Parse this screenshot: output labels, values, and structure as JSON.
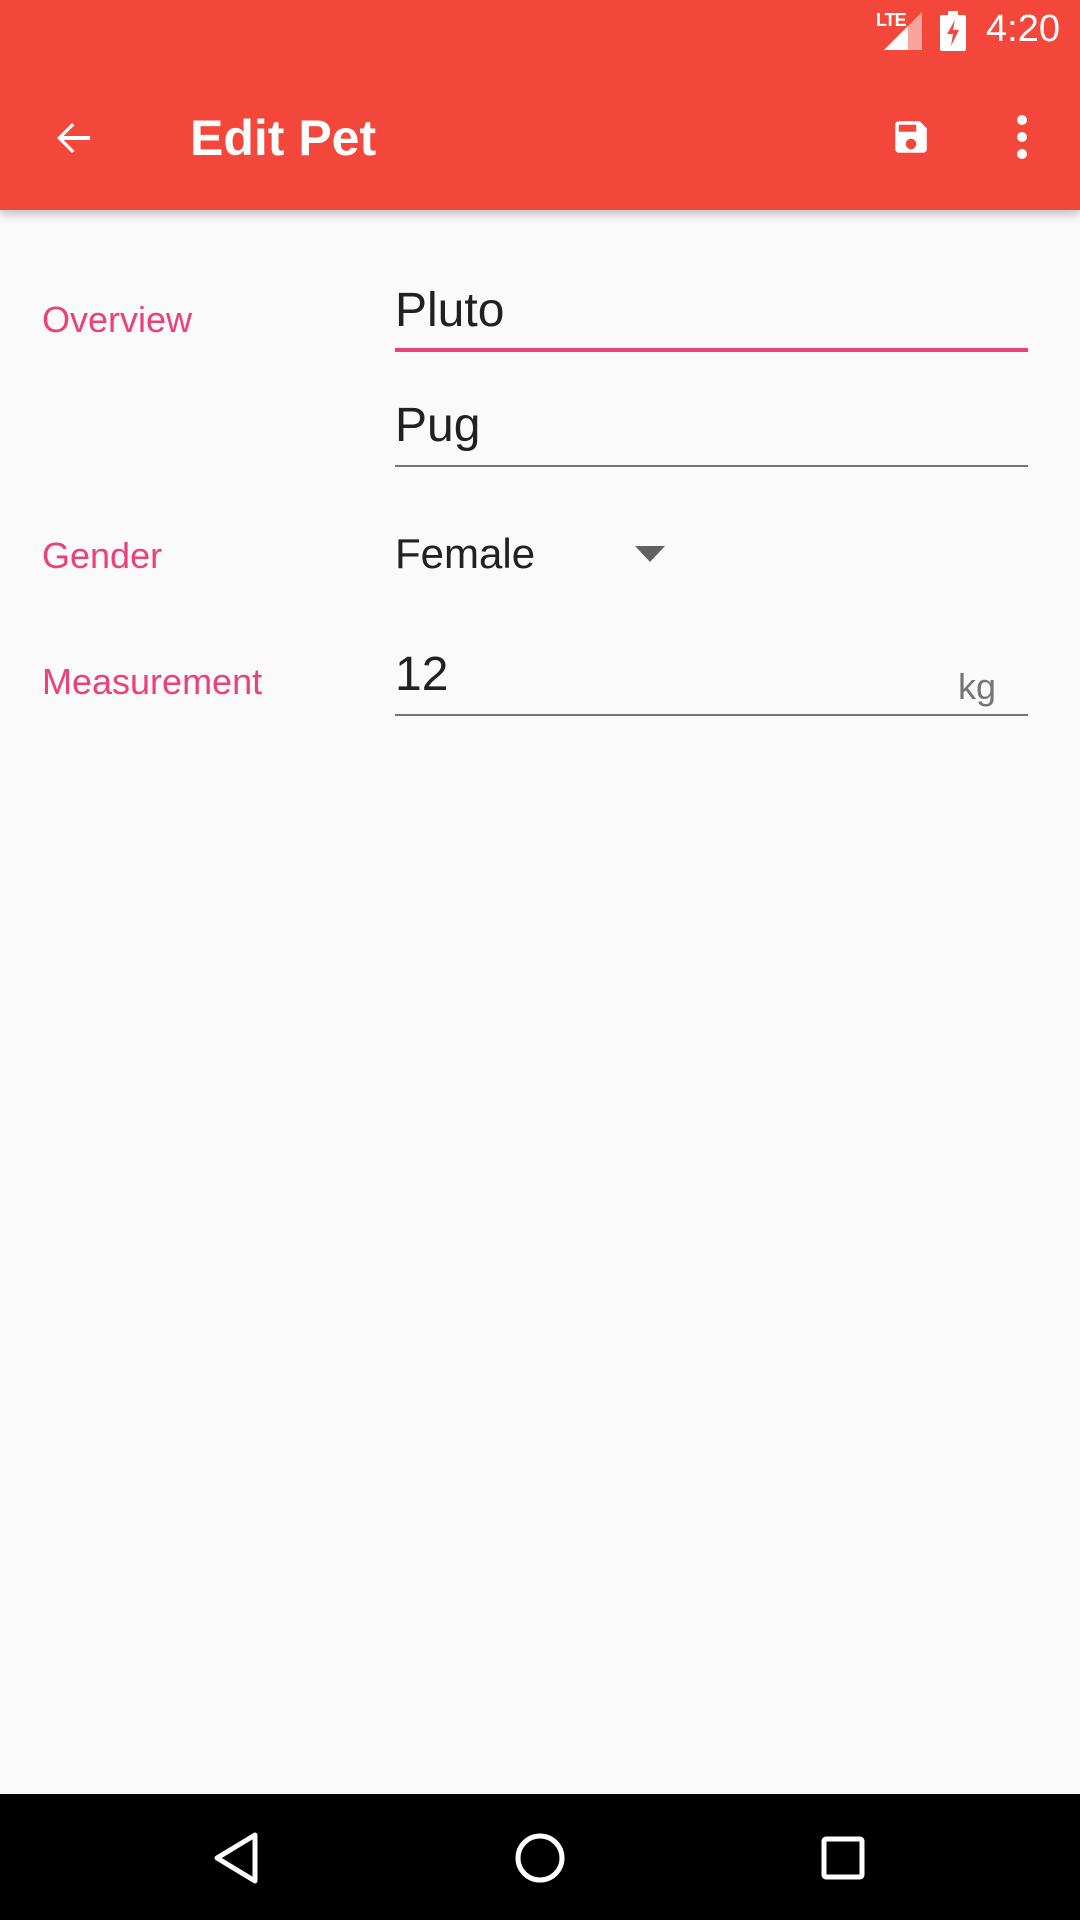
{
  "status_bar": {
    "network": "LTE",
    "time": "4:20"
  },
  "app_bar": {
    "title": "Edit Pet",
    "background_color": "#F4473B"
  },
  "form": {
    "overview_label": "Overview",
    "name_value": "Pluto",
    "breed_value": "Pug",
    "gender_label": "Gender",
    "gender_value": "Female",
    "measurement_label": "Measurement",
    "measurement_value": "12",
    "measurement_unit": "kg",
    "accent_color": "#EC407A"
  },
  "icons": {
    "back": "arrow-back-icon",
    "save": "save-icon",
    "more": "more-vert-icon",
    "nav_back": "triangle-back-icon",
    "nav_home": "circle-home-icon",
    "nav_recents": "square-recents-icon"
  }
}
